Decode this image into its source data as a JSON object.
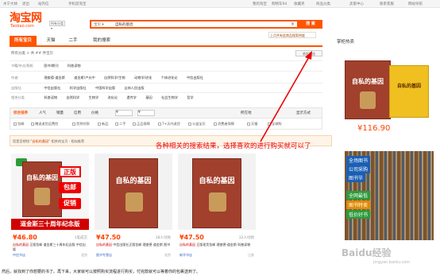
{
  "topbar": {
    "left": [
      "水宁大帅",
      "退出",
      "站内信",
      "手机逛淘宝"
    ],
    "right": [
      "我的淘宝",
      "购物车94",
      "收藏夹",
      "商品分类",
      "卖家中心",
      "联系客服",
      "网站导航"
    ]
  },
  "logo": {
    "cn": "淘宝网",
    "en": "Taobao.com"
  },
  "search": {
    "category_label": "所有分类",
    "scope": "宝贝",
    "query": "自私的基因",
    "clear_icon": "×",
    "button": "搜 索",
    "suggestion": "上月共有此商品搜索热度"
  },
  "tabs": [
    {
      "label": "所有宝贝",
      "active": true
    },
    {
      "label": "天猫",
      "active": false
    },
    {
      "label": "二手",
      "active": false
    },
    {
      "label": "我的搜索",
      "active": false
    }
  ],
  "crumb": "所有分类  >  共 ## 件宝贝",
  "fold_label": "收起筛选",
  "filter_rows": [
    {
      "label": "书籍/杂志/报纸",
      "values": [
        "图书/期刊",
        "科普读物"
      ]
    },
    {
      "label": "作者:",
      "values": [
        "理查德·道金斯",
        "道金斯/卢允中",
        "自然科学/生物",
        "动物学/进化",
        "个体进化论",
        "中信出版社"
      ]
    },
    {
      "label": "出版社:",
      "values": [
        "中信出版社",
        "科学出版社",
        "中国科学出版",
        "吉林人民出版"
      ]
    },
    {
      "label": "相关分类",
      "values": [
        "科普读物",
        "自然科学",
        "生物学",
        "进化论",
        "遗传学",
        "基因",
        "社会生物学",
        "哲学"
      ]
    }
  ],
  "sort": {
    "items": [
      {
        "label": "综合排序",
        "active": true
      },
      {
        "label": "人气",
        "active": false
      },
      {
        "label": "销量",
        "active": false
      },
      {
        "label": "信用",
        "active": false
      },
      {
        "label": "价格",
        "active": false
      }
    ],
    "price_from": "¥",
    "price_to": "¥",
    "location": "所在地",
    "display_mode": "显示方式"
  },
  "options": [
    "包邮",
    "赠送退货运费险",
    "货到付款",
    "新品",
    "二手",
    "正品保障",
    "7+天内退货",
    "公益宝贝",
    "消费者保障",
    "天猫",
    "全球购"
  ],
  "notice": {
    "prefix": "您是否想找:",
    "highlight": "\"自私的基因\" ",
    "suffix": "相关的宝贝  ·  相似推荐"
  },
  "annotation": "各种相关的搜索结果，选择喜欢的进行购买就可以了",
  "products": [
    {
      "price": "¥46.80",
      "sold": "1笔成交",
      "title_pre": "自私的基因",
      "title_post": " 正版包邮 道金斯三十周年纪念版 中信出版",
      "shop": "中信书店",
      "location": "北京",
      "badges": [
        "正版",
        "包邮",
        "促销"
      ],
      "banner": "道金斯三十周年纪念版",
      "cover_title": "自私的基因"
    },
    {
      "price": "¥47.50",
      "sold": "38人付款",
      "title_pre": "自私的基因",
      "title_post": " 中信出版社正版包邮 理查德 道金斯 图书",
      "shop": "图书专营店",
      "location": "北京",
      "cover_title": "自私的基因"
    },
    {
      "price": "¥47.50",
      "sold": "32人付款",
      "title_pre": "自私的基因",
      "title_post": " 正版现货包邮 理查德·道金斯 科普读物",
      "shop": "新华书店",
      "location": "江苏",
      "cover_title": "自私的基因"
    }
  ],
  "right_panel": {
    "title": "掌柜热卖",
    "books": [
      "自私的基因",
      "自私的基因"
    ],
    "price": "¥116.90",
    "ad_lines": [
      "全场图书",
      "公司采购",
      "图书节",
      "全网最低",
      "图书特卖",
      "低价好书"
    ]
  },
  "watermark": "Baidu经验",
  "watermark_sub": "jingyan.baidu.com",
  "bottom_text": "然后，就找到了你想要的书了。再下来，大家就可以按照购买流程进行购买，付完款就可以等着你的包裹送到了。"
}
